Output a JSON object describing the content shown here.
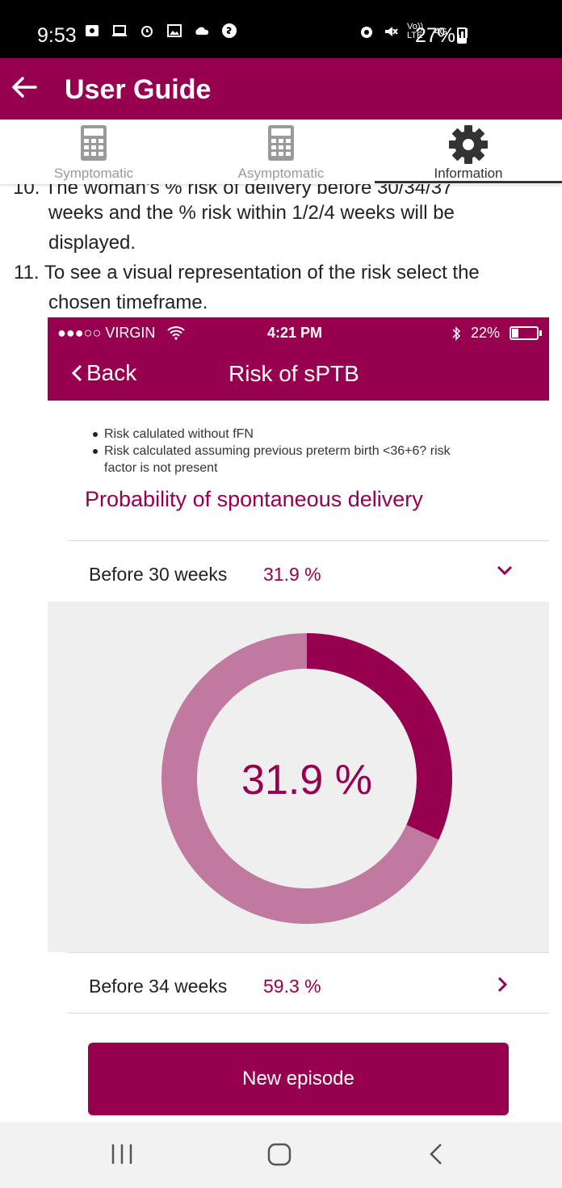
{
  "status_bar": {
    "time": "9:53",
    "battery": "27%",
    "network": "4G",
    "volte": "Vo)) LTE"
  },
  "app_bar": {
    "title": "User Guide"
  },
  "tabs": [
    {
      "label": "Symptomatic",
      "icon": "calculator-icon",
      "active": false
    },
    {
      "label": "Asymptomatic",
      "icon": "calculator-icon",
      "active": false
    },
    {
      "label": "Information",
      "icon": "gear-icon",
      "active": true
    }
  ],
  "guide": {
    "item10_cut": "10. The woman's % risk of delivery before 30/34/37",
    "item10_line2": "weeks and the % risk within 1/2/4 weeks will be",
    "item10_line3": "displayed.",
    "item11_line1": "11. To see a visual representation of the risk select the",
    "item11_line2": "chosen timeframe."
  },
  "screenshot": {
    "status": {
      "carrier": "●●●○○ VIRGIN",
      "time": "4:21 PM",
      "battery": "22%"
    },
    "nav": {
      "back_label": "Back",
      "title": "Risk of sPTB"
    },
    "bullets": [
      "Risk calulated without fFN",
      "Risk calculated assuming previous preterm birth <36+6? risk",
      "factor is not present"
    ],
    "heading": "Probability of spontaneous delivery",
    "rows": [
      {
        "label": "Before 30 weeks",
        "value": "31.9 %",
        "expanded": true
      },
      {
        "label": "Before 34 weeks",
        "value": "59.3 %",
        "expanded": false
      }
    ],
    "donut": {
      "value_label": "31.9 %",
      "fraction": 0.319,
      "color_filled": "#97004f",
      "color_rest": "#c17a9f"
    },
    "button_label": "New episode"
  },
  "colors": {
    "brand": "#97004f",
    "brand_light": "#c17a9f"
  }
}
